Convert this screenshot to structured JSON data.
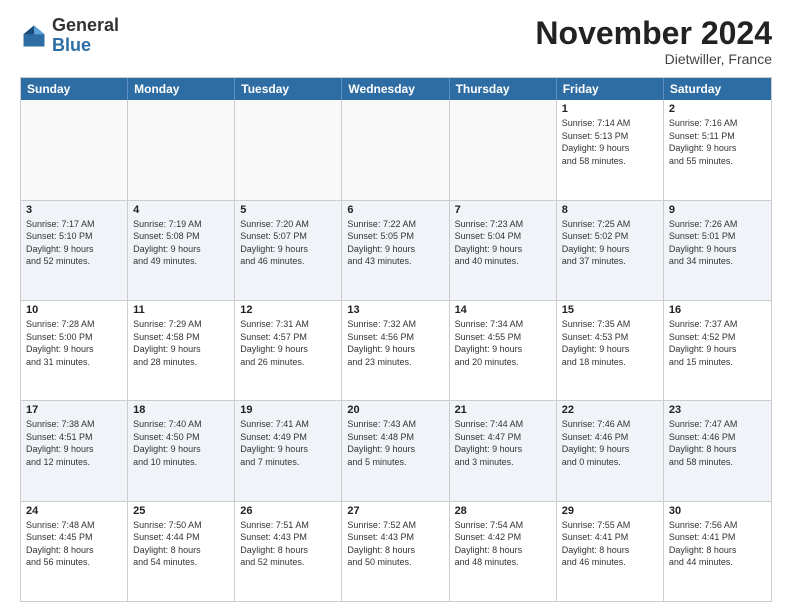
{
  "logo": {
    "general": "General",
    "blue": "Blue"
  },
  "header": {
    "month": "November 2024",
    "location": "Dietwiller, France"
  },
  "weekdays": [
    "Sunday",
    "Monday",
    "Tuesday",
    "Wednesday",
    "Thursday",
    "Friday",
    "Saturday"
  ],
  "rows": [
    {
      "cells": [
        {
          "day": "",
          "info": "",
          "empty": true
        },
        {
          "day": "",
          "info": "",
          "empty": true
        },
        {
          "day": "",
          "info": "",
          "empty": true
        },
        {
          "day": "",
          "info": "",
          "empty": true
        },
        {
          "day": "",
          "info": "",
          "empty": true
        },
        {
          "day": "1",
          "info": "Sunrise: 7:14 AM\nSunset: 5:13 PM\nDaylight: 9 hours\nand 58 minutes."
        },
        {
          "day": "2",
          "info": "Sunrise: 7:16 AM\nSunset: 5:11 PM\nDaylight: 9 hours\nand 55 minutes."
        }
      ]
    },
    {
      "cells": [
        {
          "day": "3",
          "info": "Sunrise: 7:17 AM\nSunset: 5:10 PM\nDaylight: 9 hours\nand 52 minutes."
        },
        {
          "day": "4",
          "info": "Sunrise: 7:19 AM\nSunset: 5:08 PM\nDaylight: 9 hours\nand 49 minutes."
        },
        {
          "day": "5",
          "info": "Sunrise: 7:20 AM\nSunset: 5:07 PM\nDaylight: 9 hours\nand 46 minutes."
        },
        {
          "day": "6",
          "info": "Sunrise: 7:22 AM\nSunset: 5:05 PM\nDaylight: 9 hours\nand 43 minutes."
        },
        {
          "day": "7",
          "info": "Sunrise: 7:23 AM\nSunset: 5:04 PM\nDaylight: 9 hours\nand 40 minutes."
        },
        {
          "day": "8",
          "info": "Sunrise: 7:25 AM\nSunset: 5:02 PM\nDaylight: 9 hours\nand 37 minutes."
        },
        {
          "day": "9",
          "info": "Sunrise: 7:26 AM\nSunset: 5:01 PM\nDaylight: 9 hours\nand 34 minutes."
        }
      ]
    },
    {
      "cells": [
        {
          "day": "10",
          "info": "Sunrise: 7:28 AM\nSunset: 5:00 PM\nDaylight: 9 hours\nand 31 minutes."
        },
        {
          "day": "11",
          "info": "Sunrise: 7:29 AM\nSunset: 4:58 PM\nDaylight: 9 hours\nand 28 minutes."
        },
        {
          "day": "12",
          "info": "Sunrise: 7:31 AM\nSunset: 4:57 PM\nDaylight: 9 hours\nand 26 minutes."
        },
        {
          "day": "13",
          "info": "Sunrise: 7:32 AM\nSunset: 4:56 PM\nDaylight: 9 hours\nand 23 minutes."
        },
        {
          "day": "14",
          "info": "Sunrise: 7:34 AM\nSunset: 4:55 PM\nDaylight: 9 hours\nand 20 minutes."
        },
        {
          "day": "15",
          "info": "Sunrise: 7:35 AM\nSunset: 4:53 PM\nDaylight: 9 hours\nand 18 minutes."
        },
        {
          "day": "16",
          "info": "Sunrise: 7:37 AM\nSunset: 4:52 PM\nDaylight: 9 hours\nand 15 minutes."
        }
      ]
    },
    {
      "cells": [
        {
          "day": "17",
          "info": "Sunrise: 7:38 AM\nSunset: 4:51 PM\nDaylight: 9 hours\nand 12 minutes."
        },
        {
          "day": "18",
          "info": "Sunrise: 7:40 AM\nSunset: 4:50 PM\nDaylight: 9 hours\nand 10 minutes."
        },
        {
          "day": "19",
          "info": "Sunrise: 7:41 AM\nSunset: 4:49 PM\nDaylight: 9 hours\nand 7 minutes."
        },
        {
          "day": "20",
          "info": "Sunrise: 7:43 AM\nSunset: 4:48 PM\nDaylight: 9 hours\nand 5 minutes."
        },
        {
          "day": "21",
          "info": "Sunrise: 7:44 AM\nSunset: 4:47 PM\nDaylight: 9 hours\nand 3 minutes."
        },
        {
          "day": "22",
          "info": "Sunrise: 7:46 AM\nSunset: 4:46 PM\nDaylight: 9 hours\nand 0 minutes."
        },
        {
          "day": "23",
          "info": "Sunrise: 7:47 AM\nSunset: 4:46 PM\nDaylight: 8 hours\nand 58 minutes."
        }
      ]
    },
    {
      "cells": [
        {
          "day": "24",
          "info": "Sunrise: 7:48 AM\nSunset: 4:45 PM\nDaylight: 8 hours\nand 56 minutes."
        },
        {
          "day": "25",
          "info": "Sunrise: 7:50 AM\nSunset: 4:44 PM\nDaylight: 8 hours\nand 54 minutes."
        },
        {
          "day": "26",
          "info": "Sunrise: 7:51 AM\nSunset: 4:43 PM\nDaylight: 8 hours\nand 52 minutes."
        },
        {
          "day": "27",
          "info": "Sunrise: 7:52 AM\nSunset: 4:43 PM\nDaylight: 8 hours\nand 50 minutes."
        },
        {
          "day": "28",
          "info": "Sunrise: 7:54 AM\nSunset: 4:42 PM\nDaylight: 8 hours\nand 48 minutes."
        },
        {
          "day": "29",
          "info": "Sunrise: 7:55 AM\nSunset: 4:41 PM\nDaylight: 8 hours\nand 46 minutes."
        },
        {
          "day": "30",
          "info": "Sunrise: 7:56 AM\nSunset: 4:41 PM\nDaylight: 8 hours\nand 44 minutes."
        }
      ]
    }
  ]
}
